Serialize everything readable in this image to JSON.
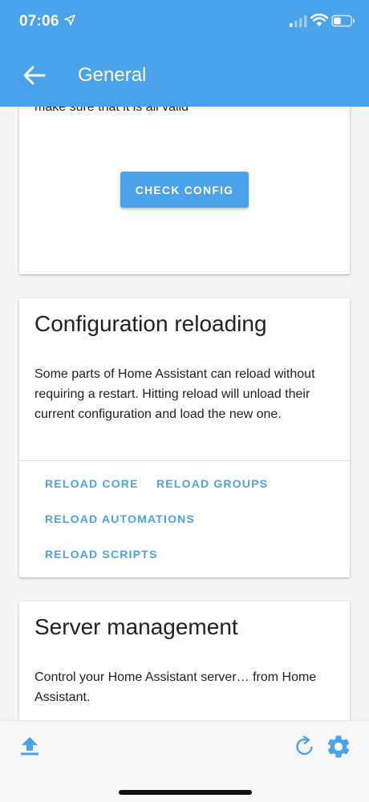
{
  "status_bar": {
    "time": "07:06"
  },
  "header": {
    "title": "General"
  },
  "card_config_check": {
    "partial_text": "make sure that it is all valid",
    "check_button_label": "CHECK CONFIG"
  },
  "card_reloading": {
    "title": "Configuration reloading",
    "description": "Some parts of Home Assistant can reload without requiring a restart. Hitting reload will unload their current configuration and load the new one.",
    "buttons": {
      "reload_core": "RELOAD CORE",
      "reload_groups": "RELOAD GROUPS",
      "reload_automations": "RELOAD AUTOMATIONS",
      "reload_scripts": "RELOAD SCRIPTS"
    }
  },
  "card_server": {
    "title": "Server management",
    "description": "Control your Home Assistant server… from Home Assistant."
  },
  "bottom_bar": {
    "icons": [
      "upload-icon",
      "refresh-icon",
      "gear-icon"
    ]
  },
  "colors": {
    "accent": "#4aa3ea",
    "text": "#212121",
    "background": "#f4f4f4"
  }
}
